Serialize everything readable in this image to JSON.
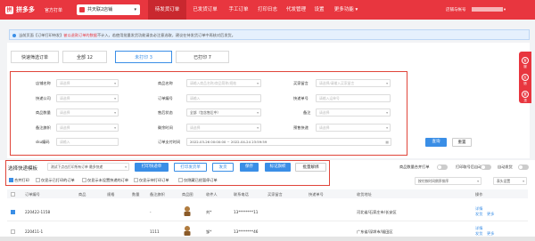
{
  "app": {
    "logo": "拼多多",
    "official": "官方打单"
  },
  "store": {
    "name": "共天联2店铺"
  },
  "nav": [
    {
      "label": "待发货订单"
    },
    {
      "label": "已发货订单"
    },
    {
      "label": "手工订单"
    },
    {
      "label": "打印日志"
    },
    {
      "label": "代发管理"
    },
    {
      "label": "设置"
    },
    {
      "label": "更多功能 ▾"
    }
  ],
  "user": {
    "label": "店铺与帐号"
  },
  "notice": {
    "prefix": "当前页面【订单打印待发】",
    "highlight": "被以退款订单的数据",
    "suffix": "不计入，若使用批量发货功能请务必注意选取，建议在待发货订单中再核对后发货。"
  },
  "tabs": [
    {
      "label": "快速筛选订单"
    },
    {
      "label": "全部 12"
    },
    {
      "label": "未打印 3"
    },
    {
      "label": "已打印 7"
    }
  ],
  "filters": [
    {
      "label": "店铺名称",
      "placeholder": "请选择"
    },
    {
      "label": "商品名称",
      "placeholder": "请输入商品名称/商品简称/规格"
    },
    {
      "label": "买家留言",
      "placeholder": "请选择/请输入买家留言"
    },
    {
      "label": "快递公司",
      "placeholder": "请选择"
    },
    {
      "label": "订单编号",
      "placeholder": "请输入"
    },
    {
      "label": "快递单号",
      "placeholder": "请输入运单号"
    },
    {
      "label": "商品数量",
      "placeholder": "请选择"
    },
    {
      "label": "售后状态",
      "value": "全部（包含售后中）"
    },
    {
      "label": "备注",
      "placeholder": "请选择"
    },
    {
      "label": "备注旗帜",
      "placeholder": "请选择"
    },
    {
      "label": "剩余时间",
      "placeholder": "请选择"
    },
    {
      "label": "预售快递",
      "placeholder": "请选择"
    },
    {
      "label": "sku编码",
      "placeholder": "请输入"
    },
    {
      "label": "订单支付时间",
      "value": "2022-03-26 00:00:00 ~ 2022-04-24 23:59:59"
    }
  ],
  "actions": {
    "search": "查询",
    "reset": "重置"
  },
  "toolbar": {
    "select_template": "选择快递模板",
    "template_hint": "测试下点击打印所有订单 最多快递",
    "print_express": "打印快递单",
    "print_invoice": "打印发货单",
    "ship": "发货",
    "save": "保存",
    "batch_tag": "标记旗帜",
    "batch_unlink": "批量解绑",
    "opt_all_print": "合并打印",
    "opt_print_marked": "仅显示已打印的订单",
    "opt_print_all": "仅显示未设置快递的订单",
    "opt_only_unmerged": "仅显示待打印订单",
    "opt_hide": "仅隐藏已经暂停订单",
    "t_auto_merge": "商品数量合并打单",
    "t_split": "打印取号后自动发货",
    "t_print_qty": "自动发货",
    "sort": "按付款时间倒序排序",
    "custom": "表头设置"
  },
  "table": {
    "headers": [
      "订单编号",
      "商品",
      "规格",
      "数量",
      "备注旗帜",
      "商品图",
      "收件人",
      "联系电话",
      "买家留言",
      "快递单号",
      "收货地址",
      "操作"
    ]
  },
  "rows": [
    {
      "order": "220422-1158",
      "flag": "-",
      "recipient": "刘*",
      "phone": "13********11",
      "address": "河北省/石家庄市/长安区",
      "op1": "详情",
      "op2": "发货",
      "op3": "更多"
    },
    {
      "order": "220411-1",
      "flag": "1111",
      "recipient": "邹*",
      "phone": "13********46",
      "address": "广东省/深圳市/福田区",
      "op1": "详情",
      "op2": "发货",
      "op3": "更多"
    }
  ],
  "side": [
    "客服",
    "反馈",
    "置顶"
  ],
  "colors": {
    "brand": "#e8363f",
    "accent": "#3a8ee6",
    "outline": "#e0453a"
  }
}
